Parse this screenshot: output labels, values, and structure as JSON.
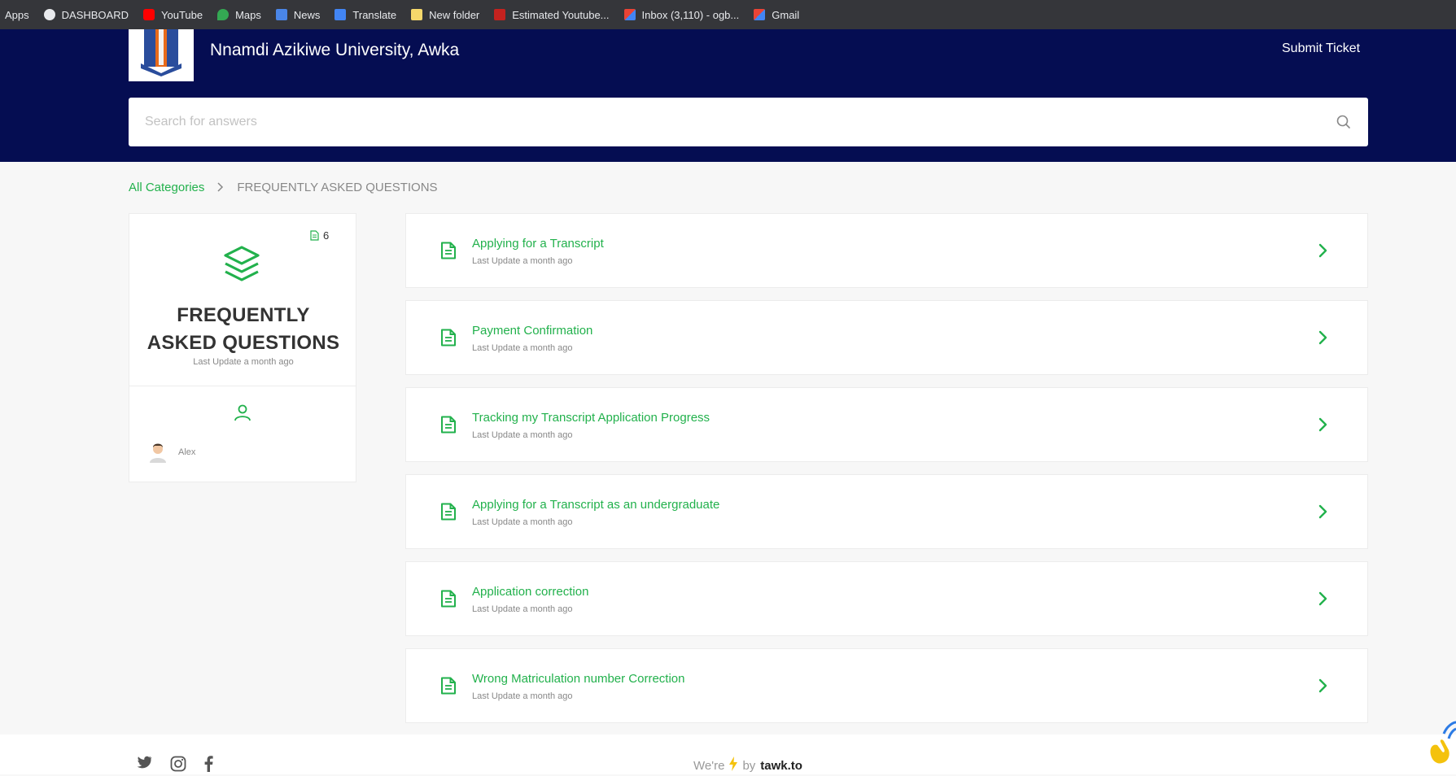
{
  "bookmarks": [
    {
      "label": "Apps",
      "icon": "apps-icon"
    },
    {
      "label": "DASHBOARD",
      "icon": "globe-icon"
    },
    {
      "label": "YouTube",
      "icon": "youtube-icon"
    },
    {
      "label": "Maps",
      "icon": "maps-icon"
    },
    {
      "label": "News",
      "icon": "news-icon"
    },
    {
      "label": "Translate",
      "icon": "translate-icon"
    },
    {
      "label": "New folder",
      "icon": "folder-icon"
    },
    {
      "label": "Estimated Youtube...",
      "icon": "chart-icon"
    },
    {
      "label": "Inbox (3,110) - ogb...",
      "icon": "gmail-icon"
    },
    {
      "label": "Gmail",
      "icon": "gmail-icon"
    }
  ],
  "header": {
    "site_title": "Nnamdi Azikiwe University, Awka",
    "submit_ticket": "Submit Ticket",
    "search_placeholder": "Search for answers",
    "bg_color": "#050d52"
  },
  "breadcrumb": {
    "root": "All Categories",
    "current": "FREQUENTLY ASKED QUESTIONS"
  },
  "category": {
    "count": "6",
    "name_line1": "FREQUENTLY",
    "name_line2": "ASKED QUESTIONS",
    "update_label": "Last Update",
    "update_value": "a month ago",
    "author": "Alex"
  },
  "articles": [
    {
      "title": "Applying for a Transcript",
      "update_label": "Last Update",
      "update_value": "a month ago"
    },
    {
      "title": "Payment Confirmation",
      "update_label": "Last Update",
      "update_value": "a month ago"
    },
    {
      "title": "Tracking my Transcript Application Progress",
      "update_label": "Last Update",
      "update_value": "a month ago"
    },
    {
      "title": "Applying for a Transcript as an undergraduate",
      "update_label": "Last Update",
      "update_value": "a month ago"
    },
    {
      "title": "Application correction",
      "update_label": "Last Update",
      "update_value": "a month ago"
    },
    {
      "title": "Wrong Matriculation number Correction",
      "update_label": "Last Update",
      "update_value": "a month ago"
    }
  ],
  "footer": {
    "powered_prefix": "We're",
    "powered_by": "by",
    "brand": "tawk.to"
  },
  "colors": {
    "accent": "#22b14c"
  }
}
